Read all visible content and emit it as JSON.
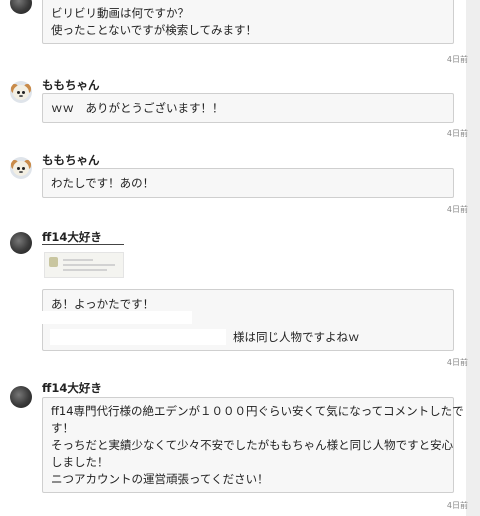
{
  "comments": [
    {
      "username": "",
      "avatar": "dark-avatar-icon",
      "lines": [
        "ビリビリ動画は何ですか？",
        "使ったことないですが検索してみます！"
      ],
      "time": "4日前"
    },
    {
      "username": "ももちゃん",
      "avatar": "pet-avatar-icon",
      "lines": [
        "ｗｗ　ありがとうございます！！"
      ],
      "time": "4日前"
    },
    {
      "username": "ももちゃん",
      "avatar": "pet-avatar-icon",
      "lines": [
        "わたしです！あの！"
      ],
      "time": "4日前"
    },
    {
      "username": "ff14大好き",
      "avatar": "dark-avatar-icon",
      "attachment": "screenshot-thumbnail",
      "lines": [
        "あ！よっかたです！",
        "様は同じ人物ですよねｗ"
      ],
      "time": "4日前"
    },
    {
      "username": "ff14大好き",
      "avatar": "dark-avatar-icon",
      "lines": [
        "ff14専門代行様の絶エデンが１０００円ぐらい安くて気になってコメントしたで",
        "す！",
        "そっちだと実績少なくて少々不安でしたがももちゃん様と同じ人物ですと安心",
        "しました！",
        "ニつアカウントの運営頑張ってください！"
      ],
      "time": "4日前"
    }
  ]
}
